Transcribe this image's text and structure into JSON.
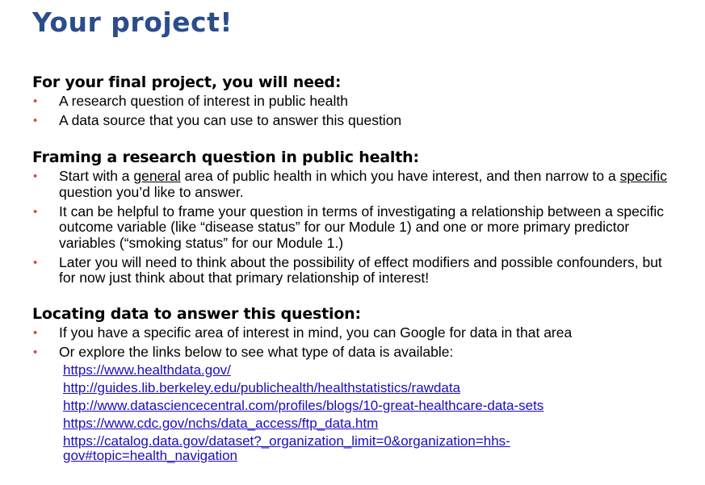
{
  "title": "Your project!",
  "section1": {
    "heading": "For your final project, you will need:",
    "bullets": [
      "A research question of interest in public health",
      "A data source that you can use to answer this question"
    ]
  },
  "section2": {
    "heading": "Framing a research question in public health:",
    "b1": {
      "part1": "Start with a ",
      "underline1": "general",
      "part2": " area of public health in which you have interest, and then narrow to a ",
      "underline2": "specific",
      "part3": " question you’d like to answer."
    },
    "b2": "It can be helpful to frame your question in terms of investigating a relationship between a specific outcome variable (like “disease status” for our Module 1) and one or more primary predictor variables (“smoking status” for our Module 1.)",
    "b3": "Later you will need to think about the possibility of effect modifiers and possible confounders, but for now just think about that primary relationship of interest!"
  },
  "section3": {
    "heading": "Locating data to answer this question:",
    "bullets": [
      "If you have a specific area of interest in mind, you can Google for data in that area",
      "Or explore the links below to see what type of data is available:"
    ],
    "links": [
      "https://www.healthdata.gov/",
      "http://guides.lib.berkeley.edu/publichealth/healthstatistics/rawdata",
      "http://www.datasciencecentral.com/profiles/blogs/10-great-healthcare-data-sets",
      "https://www.cdc.gov/nchs/data_access/ftp_data.htm",
      "https://catalog.data.gov/dataset?_organization_limit=0&organization=hhs-gov#topic=health_navigation"
    ]
  },
  "colors": {
    "title": "#2b4d8c",
    "bullet": "#d0504a",
    "link": "#1a0dbf"
  }
}
